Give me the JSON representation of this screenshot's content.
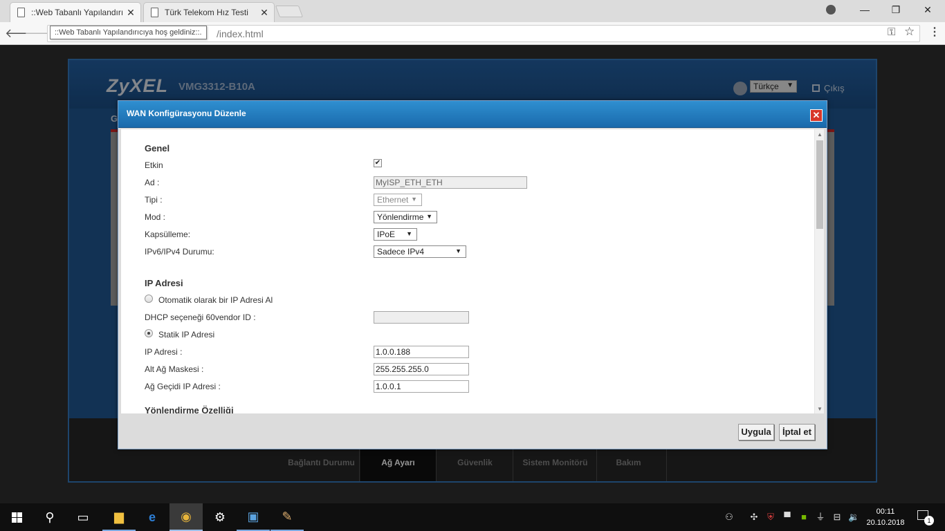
{
  "browser": {
    "tabs": [
      {
        "title": "::Web Tabanlı Yapılandırıcıya hoş geldiniz::",
        "close": "✕"
      },
      {
        "title": "Türk Telekom Hız Testi",
        "close": "✕"
      }
    ],
    "url": "/index.html",
    "tooltip": "::Web Tabanlı Yapılandırıcıya hoş geldiniz::.",
    "icons": {
      "back": "🡐",
      "forward": "🡒",
      "key": "⚿",
      "star": "☆",
      "menu": "⋮",
      "minimize": "—",
      "restore": "❐",
      "close": "✕"
    }
  },
  "router": {
    "brand": "ZyXEL",
    "model": "VMG3312-B10A",
    "language": "Türkçe",
    "logout": "Çıkış",
    "partial_heading": "G",
    "nav": [
      "Bağlantı Durumu",
      "Ağ Ayarı",
      "Güvenlik",
      "Sistem Monitörü",
      "Bakım"
    ]
  },
  "modal": {
    "title": "WAN Konfigürasyonu Düzenle",
    "close_symbol": "✕",
    "general": {
      "title": "Genel",
      "enabled_label": "Etkin",
      "enabled_checked": true,
      "name_label": "Ad :",
      "name_value": "MyISP_ETH_ETH",
      "type_label": "Tipi :",
      "type_value": "Ethernet",
      "mode_label": "Mod :",
      "mode_value": "Yönlendirme",
      "encap_label": "Kapsülleme:",
      "encap_value": "IPoE",
      "ipver_label": "IPv6/IPv4 Durumu:",
      "ipver_value": "Sadece IPv4"
    },
    "ip": {
      "title": "IP Adresi",
      "auto_label": "Otomatik olarak bir IP Adresi Al",
      "dhcp_label": "DHCP seçeneği 60vendor ID :",
      "dhcp_value": "",
      "static_label": "Statik IP Adresi",
      "ip_label": "IP Adresi :",
      "ip_value": "1.0.0.188",
      "mask_label": "Alt Ağ Maskesi :",
      "mask_value": "255.255.255.0",
      "gateway_label": "Ağ Geçidi IP Adresi :",
      "gateway_value": "1.0.0.1"
    },
    "routing_title": "Yönlendirme Özelliği",
    "apply": "Uygula",
    "cancel": "İptal et"
  },
  "taskbar": {
    "time": "00:11",
    "date": "20.10.2018",
    "notification_count": "1"
  }
}
